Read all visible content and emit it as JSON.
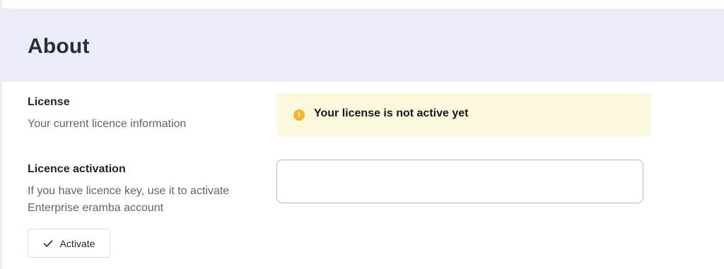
{
  "header": {
    "title": "About"
  },
  "license": {
    "title": "License",
    "description": "Your current licence information",
    "alert_icon": "warning-circle-icon",
    "alert_icon_glyph": "!",
    "alert_text": "Your license is not active yet",
    "alert_color": "#f3b62a",
    "alert_background": "#fbf8dd"
  },
  "activation": {
    "title": "Licence activation",
    "description": "If you have licence key, use it to activate Enterprise eramba account",
    "input_value": "",
    "input_placeholder": "",
    "button_icon": "check-icon",
    "button_label": "Activate"
  },
  "colors": {
    "header_background": "#ebedfa",
    "muted_text": "#5d6472"
  }
}
